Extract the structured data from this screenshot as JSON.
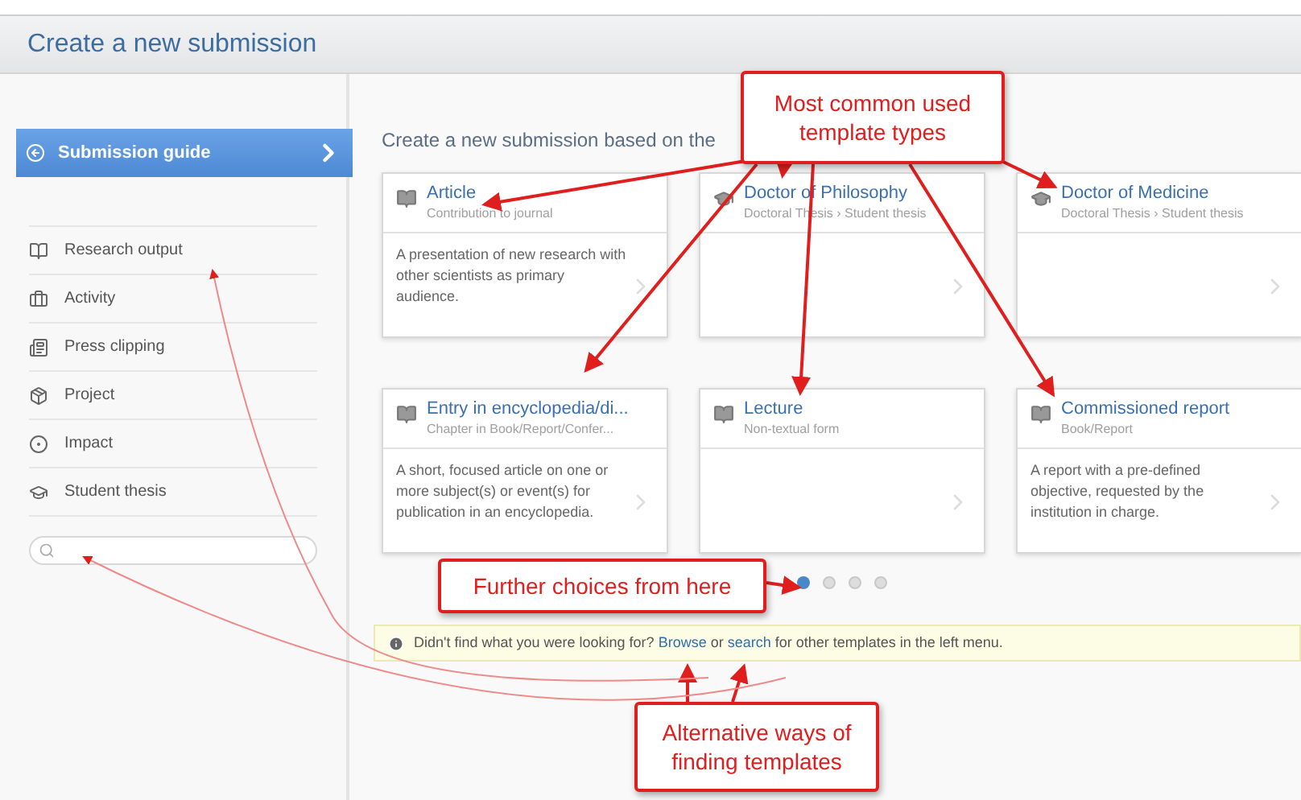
{
  "header": {
    "title": "Create a new submission"
  },
  "sidebar": {
    "guide": {
      "label": "Submission guide",
      "selected": true
    },
    "items": [
      {
        "label": "Research output"
      },
      {
        "label": "Activity"
      },
      {
        "label": "Press clipping"
      },
      {
        "label": "Project"
      },
      {
        "label": "Impact"
      },
      {
        "label": "Student thesis"
      }
    ]
  },
  "main": {
    "heading": "Create a new submission based on the",
    "templates": [
      {
        "kind": "publication",
        "title": "Article",
        "subtitle": "Contribution to journal",
        "description": "A presentation of new research with other scientists as primary audience."
      },
      {
        "kind": "thesis",
        "title": "Doctor of Philosophy",
        "subtitle": "Doctoral Thesis › Student thesis"
      },
      {
        "kind": "thesis",
        "title": "Doctor of Medicine",
        "subtitle": "Doctoral Thesis › Student thesis"
      },
      {
        "kind": "publication",
        "title": "Entry in encyclopedia/di...",
        "subtitle": "Chapter in Book/Report/Confer...",
        "description": "A short, focused article on one or more subject(s) or event(s) for publication in an encyclopedia."
      },
      {
        "kind": "publication",
        "title": "Lecture",
        "subtitle": "Non-textual form"
      },
      {
        "kind": "publication",
        "title": "Commissioned report",
        "subtitle": "Book/Report",
        "description": "A report with a pre-defined objective, requested by the institution in charge."
      }
    ],
    "pager": [
      {
        "selected": true
      },
      {
        "selected": false
      },
      {
        "selected": false
      },
      {
        "selected": false
      }
    ],
    "info": {
      "before": "Didn't find what you were looking for? ",
      "link1": "Browse",
      "middle": " or ",
      "link2": "search",
      "after": " for other templates in the left menu."
    }
  },
  "annotations": [
    {
      "text": "Most common used template types"
    },
    {
      "text": "Further choices from here"
    },
    {
      "text": "Alternative ways of finding templates"
    }
  ]
}
